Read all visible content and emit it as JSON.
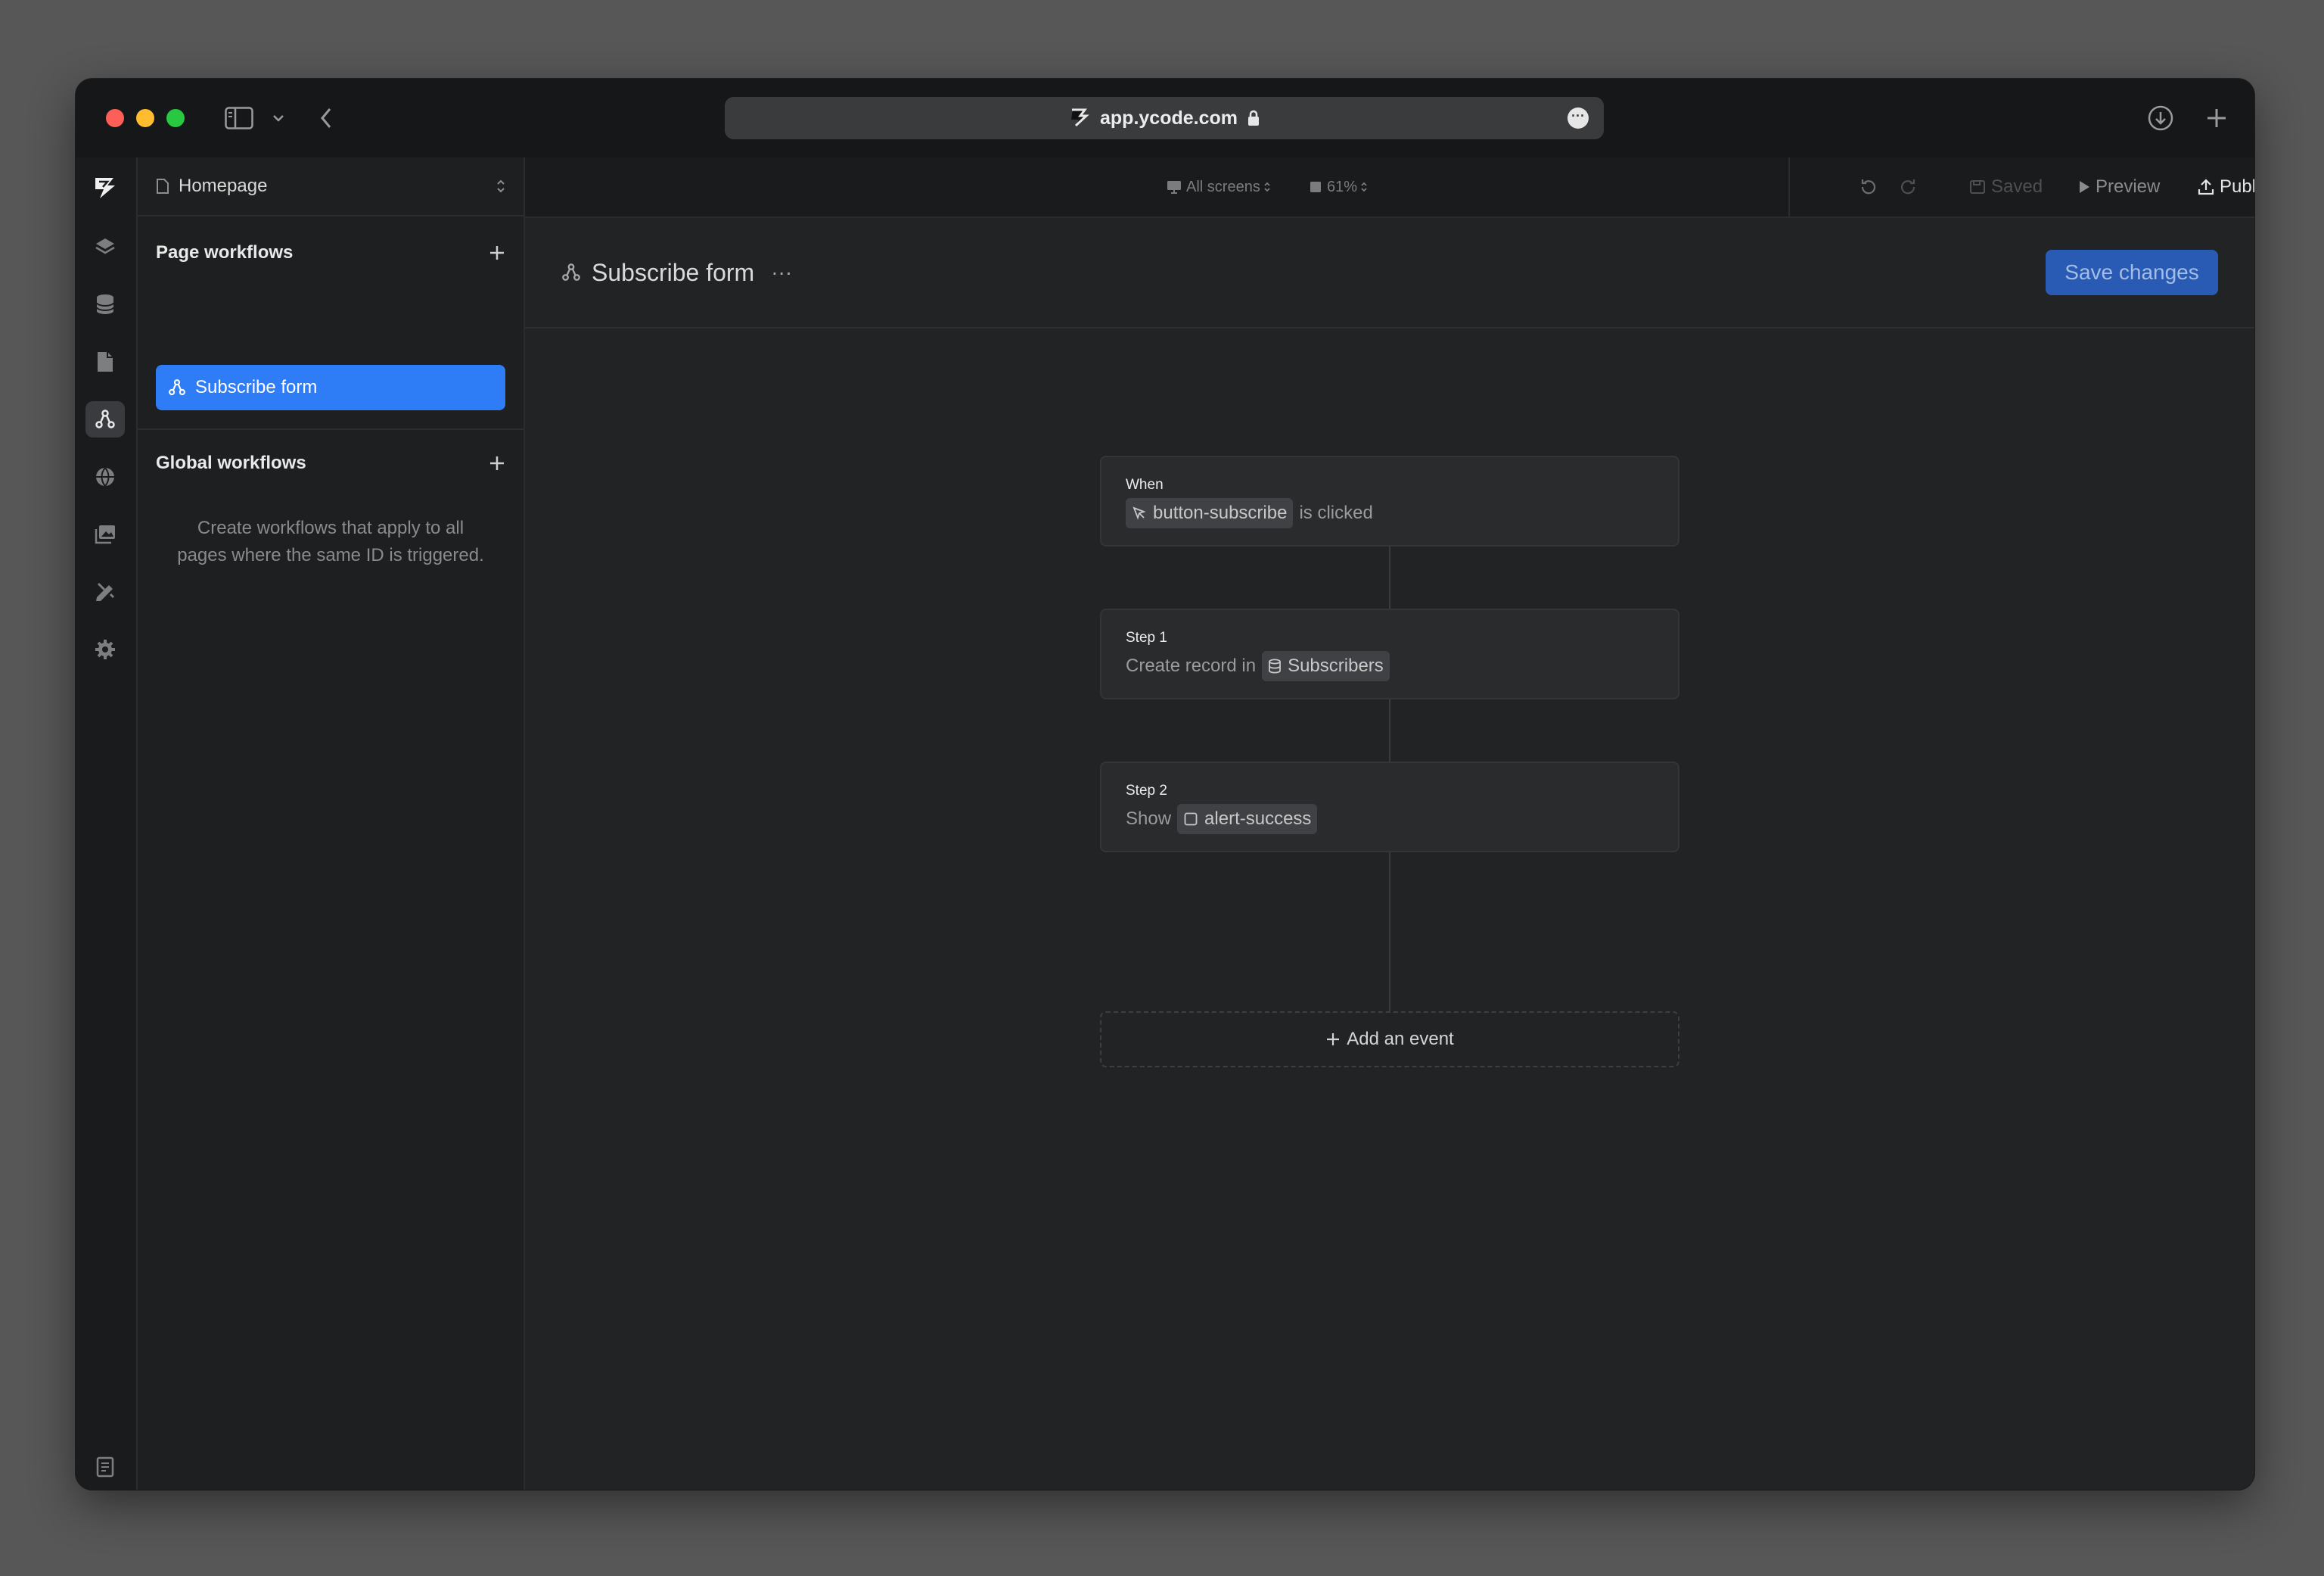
{
  "browser": {
    "url": "app.ycode.com"
  },
  "sidebar": {
    "page_select": "Homepage",
    "page_workflows_title": "Page workflows",
    "workflows": [
      {
        "label": "Subscribe form",
        "selected": true
      }
    ],
    "global_workflows_title": "Global workflows",
    "global_empty_text": "Create workflows that apply to all pages where the same ID is triggered."
  },
  "toolbar": {
    "screens_label": "All screens",
    "zoom_label": "61%",
    "saved_label": "Saved",
    "preview_label": "Preview",
    "publish_label": "Publish"
  },
  "workflow": {
    "title": "Subscribe form",
    "save_label": "Save changes",
    "trigger": {
      "label": "When",
      "element": "button-subscribe",
      "action": "is clicked"
    },
    "steps": [
      {
        "label": "Step 1",
        "prefix": "Create record in",
        "target": "Subscribers"
      },
      {
        "label": "Step 2",
        "prefix": "Show",
        "target": "alert-success"
      }
    ],
    "add_event_label": "Add an event"
  },
  "colors": {
    "accent": "#2f7df6",
    "save_button": "#2a5bb4",
    "background": "#222324"
  }
}
